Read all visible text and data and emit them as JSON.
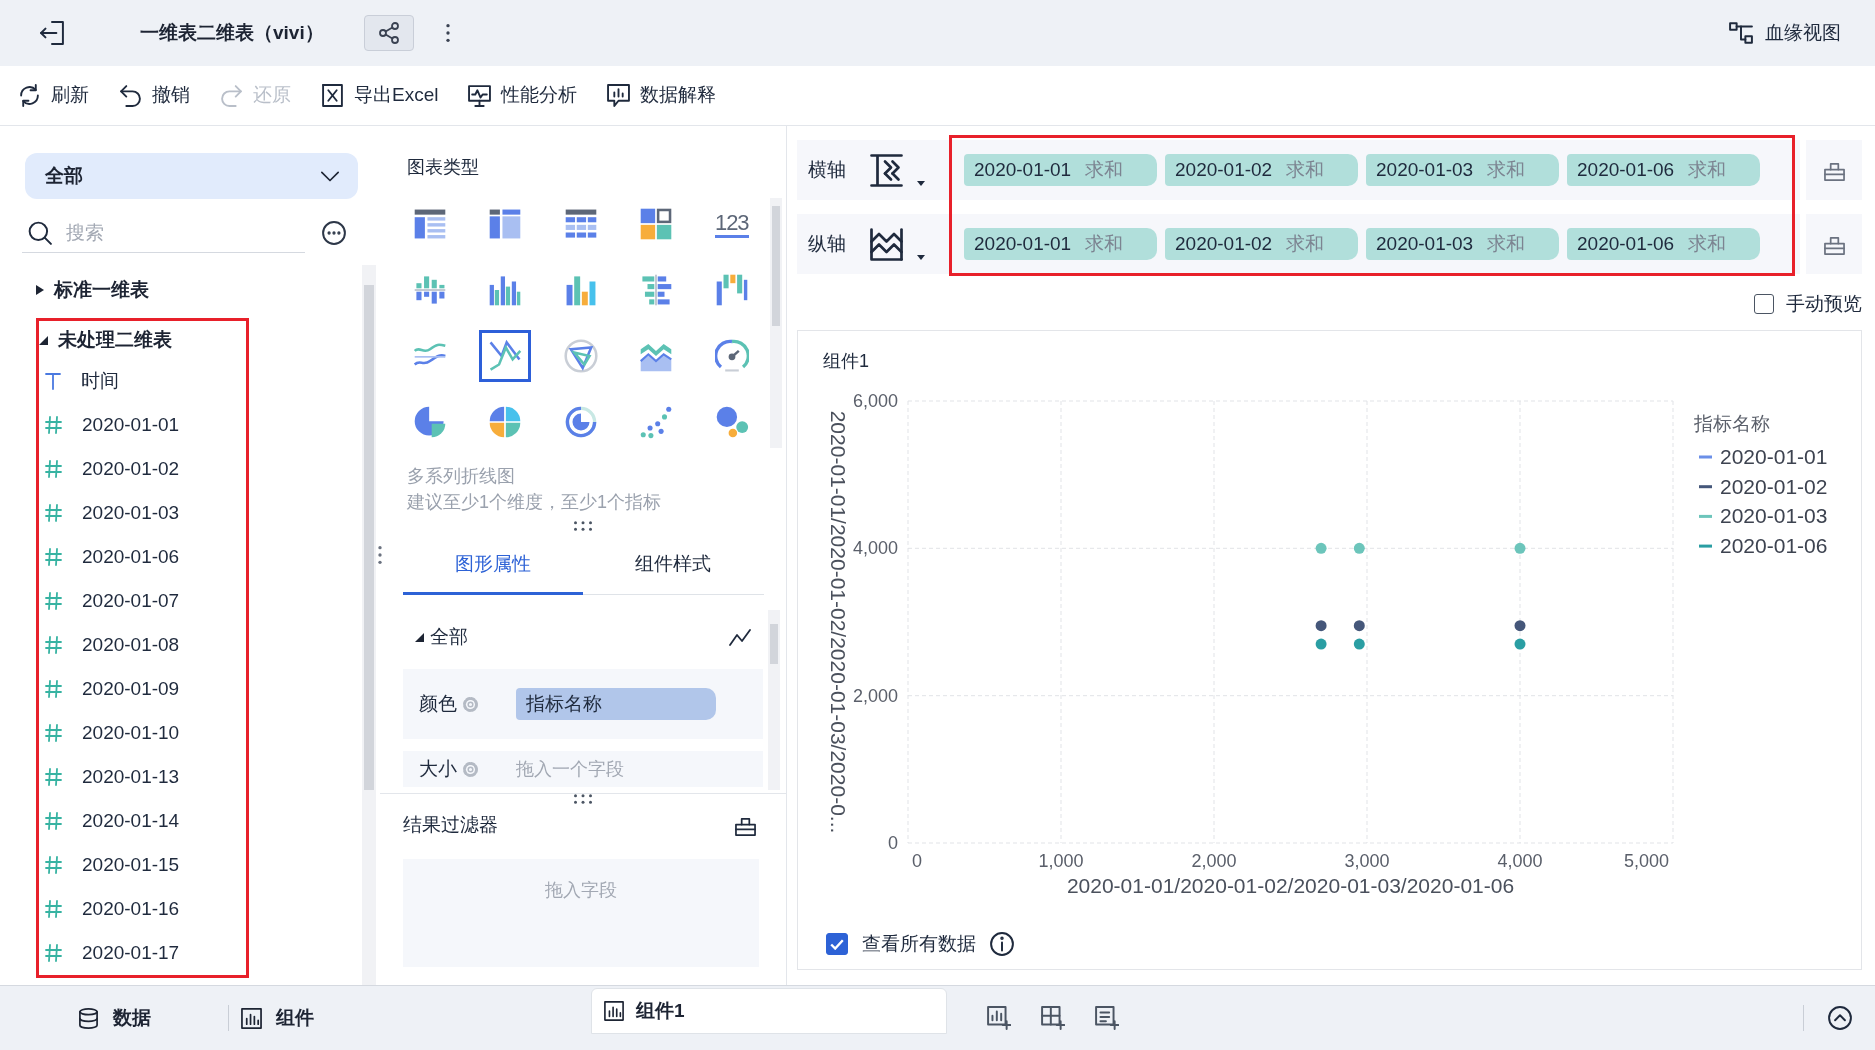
{
  "header": {
    "title": "一维表二维表（vivi）",
    "lineage_label": "血缘视图"
  },
  "toolbar": [
    {
      "kind": "refresh",
      "label": "刷新",
      "disabled": false
    },
    {
      "kind": "undo",
      "label": "撤销",
      "disabled": false
    },
    {
      "kind": "redo",
      "label": "还原",
      "disabled": true
    },
    {
      "kind": "export",
      "label": "导出Excel",
      "disabled": false
    },
    {
      "kind": "performance",
      "label": "性能分析",
      "disabled": false
    },
    {
      "kind": "explain",
      "label": "数据解释",
      "disabled": false
    }
  ],
  "data_panel": {
    "scope": "全部",
    "search": {
      "placeholder": "搜索"
    },
    "tree": [
      {
        "label": "标准一维表",
        "expanded": false,
        "highlighted": false
      },
      {
        "label": "未处理二维表",
        "expanded": true,
        "highlighted": true,
        "children": [
          {
            "kind": "text",
            "label": "时间"
          },
          {
            "kind": "number",
            "label": "2020-01-01"
          },
          {
            "kind": "number",
            "label": "2020-01-02"
          },
          {
            "kind": "number",
            "label": "2020-01-03"
          },
          {
            "kind": "number",
            "label": "2020-01-06"
          },
          {
            "kind": "number",
            "label": "2020-01-07"
          },
          {
            "kind": "number",
            "label": "2020-01-08"
          },
          {
            "kind": "number",
            "label": "2020-01-09"
          },
          {
            "kind": "number",
            "label": "2020-01-10"
          },
          {
            "kind": "number",
            "label": "2020-01-13"
          },
          {
            "kind": "number",
            "label": "2020-01-14"
          },
          {
            "kind": "number",
            "label": "2020-01-15"
          },
          {
            "kind": "number",
            "label": "2020-01-16"
          },
          {
            "kind": "number",
            "label": "2020-01-17"
          }
        ]
      }
    ]
  },
  "chart_panel": {
    "title": "图表类型",
    "chart_types": [
      {
        "kind": "table",
        "selected": false
      },
      {
        "kind": "pivot",
        "selected": false
      },
      {
        "kind": "grid",
        "selected": false
      },
      {
        "kind": "tiles",
        "selected": false
      },
      {
        "kind": "kpi",
        "label": "123",
        "selected": false
      },
      {
        "kind": "stacked-bar",
        "selected": false
      },
      {
        "kind": "grouped-bar",
        "selected": false
      },
      {
        "kind": "bar",
        "selected": false
      },
      {
        "kind": "horizontal-bar",
        "selected": false
      },
      {
        "kind": "floating-bar",
        "selected": false
      },
      {
        "kind": "line",
        "selected": false
      },
      {
        "kind": "multi-line",
        "selected": true
      },
      {
        "kind": "radar",
        "selected": false
      },
      {
        "kind": "area",
        "selected": false
      },
      {
        "kind": "gauge",
        "selected": false
      },
      {
        "kind": "pie",
        "selected": false
      },
      {
        "kind": "multicolor-pie",
        "selected": false
      },
      {
        "kind": "donut",
        "selected": false
      },
      {
        "kind": "scatter",
        "selected": false
      },
      {
        "kind": "bubble",
        "selected": false
      }
    ],
    "description": "多系列折线图",
    "hint": "建议至少1个维度，至少1个指标",
    "tabs": [
      {
        "label": "图形属性",
        "selected": true
      },
      {
        "label": "组件样式",
        "selected": false
      }
    ],
    "section": {
      "label": "全部",
      "expanded": true
    },
    "properties": [
      {
        "label": "颜色",
        "value": "指标名称"
      },
      {
        "label": "大小",
        "drop_hint": "拖入一个字段"
      }
    ],
    "filter": {
      "title": "结果过滤器",
      "drop_hint": "拖入字段"
    }
  },
  "axes": {
    "highlighted": true,
    "rows": [
      {
        "kind": "x",
        "label": "横轴",
        "fields": [
          {
            "name": "2020-01-01",
            "aggregate": "求和"
          },
          {
            "name": "2020-01-02",
            "aggregate": "求和"
          },
          {
            "name": "2020-01-03",
            "aggregate": "求和"
          },
          {
            "name": "2020-01-06",
            "aggregate": "求和"
          }
        ]
      },
      {
        "kind": "y",
        "label": "纵轴",
        "fields": [
          {
            "name": "2020-01-01",
            "aggregate": "求和"
          },
          {
            "name": "2020-01-02",
            "aggregate": "求和"
          },
          {
            "name": "2020-01-03",
            "aggregate": "求和"
          },
          {
            "name": "2020-01-06",
            "aggregate": "求和"
          }
        ]
      }
    ]
  },
  "manual_preview": {
    "label": "手动预览",
    "checked": false
  },
  "component": {
    "title": "组件1",
    "chart_data": {
      "type": "scatter",
      "xlabel": "2020-01-01/2020-01-02/2020-01-03/2020-01-06",
      "ylabel": "2020-01-01/2020-01-02/2020-01-03/2020-0...",
      "x": [
        2700,
        2950,
        4000
      ],
      "series": [
        {
          "name": "2020-01-01",
          "color": "#6b8fe8",
          "values": [
            null,
            null,
            null
          ]
        },
        {
          "name": "2020-01-02",
          "color": "#45577a",
          "values": [
            2950,
            2950,
            2950
          ]
        },
        {
          "name": "2020-01-03",
          "color": "#6cc5bb",
          "values": [
            4000,
            4000,
            4000
          ]
        },
        {
          "name": "2020-01-06",
          "color": "#2a9ea3",
          "values": [
            2700,
            2700,
            2700
          ]
        }
      ],
      "xlim": [
        0,
        5000
      ],
      "ylim": [
        0,
        6000
      ],
      "xticks": [
        {
          "value": 0,
          "label": "0"
        },
        {
          "value": 1000,
          "label": "1,000"
        },
        {
          "value": 2000,
          "label": "2,000"
        },
        {
          "value": 3000,
          "label": "3,000"
        },
        {
          "value": 4000,
          "label": "4,000"
        },
        {
          "value": 5000,
          "label": "5,000"
        }
      ],
      "yticks": [
        {
          "value": 0,
          "label": "0"
        },
        {
          "value": 2000,
          "label": "2,000"
        },
        {
          "value": 4000,
          "label": "4,000"
        },
        {
          "value": 6000,
          "label": "6,000"
        }
      ],
      "grid": true,
      "legend": {
        "title": "指标名称"
      }
    },
    "view_all": {
      "label": "查看所有数据",
      "checked": true
    }
  },
  "bottom_bar": {
    "panels": [
      {
        "kind": "data",
        "label": "数据"
      },
      {
        "kind": "component",
        "label": "组件"
      }
    ],
    "pages": [
      {
        "label": "组件1",
        "selected": true
      }
    ]
  }
}
